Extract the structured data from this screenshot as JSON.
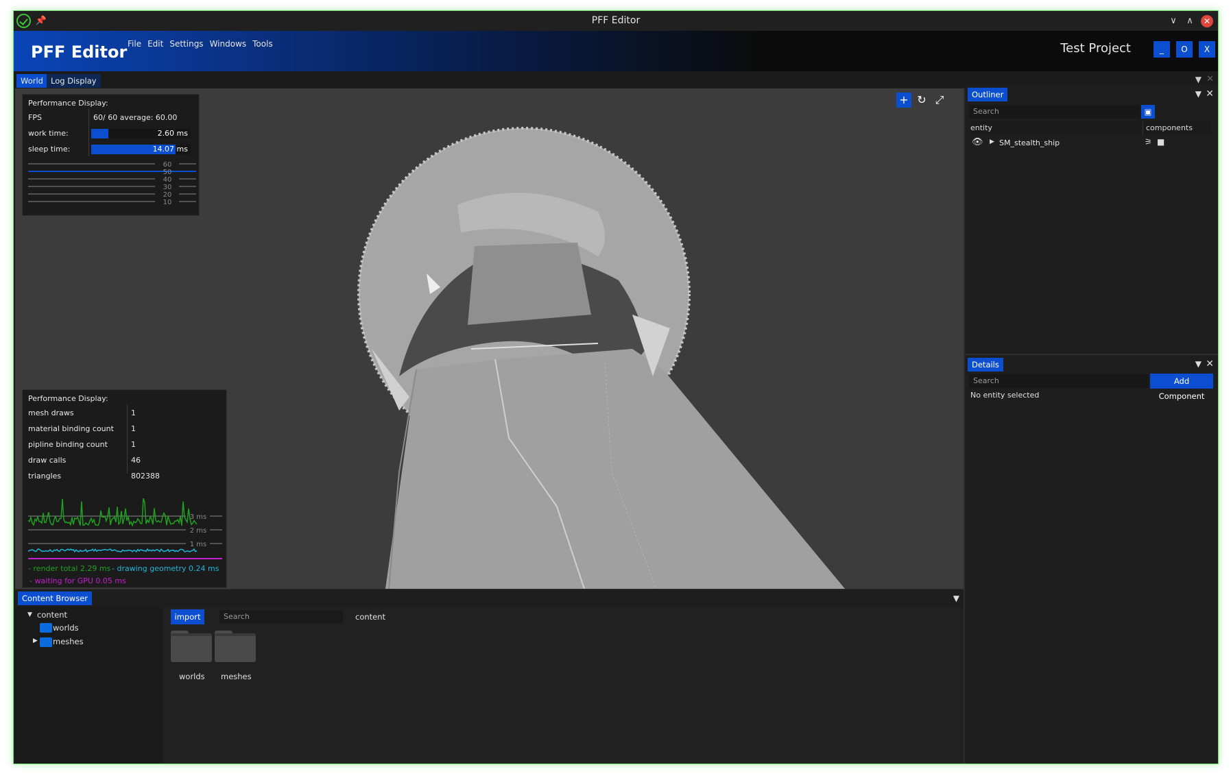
{
  "window": {
    "title": "PFF Editor"
  },
  "header": {
    "brand": "PFF Editor",
    "menu": [
      "File",
      "Edit",
      "Settings",
      "Windows",
      "Tools"
    ],
    "project": "Test Project",
    "buttons": [
      "_",
      "O",
      "X"
    ]
  },
  "tabs": [
    {
      "label": "World",
      "active": true
    },
    {
      "label": "Log Display",
      "active": false
    }
  ],
  "perf_top": {
    "title": "Performance Display:",
    "fps_label": "FPS",
    "fps_value": "60/  60  average: 60.00",
    "work_label": "work time:",
    "work_value": "2.60 ms",
    "work_fraction": 0.17,
    "sleep_label": "sleep time:",
    "sleep_value": "14.07 ms",
    "sleep_fraction": 0.85,
    "graph_ticks": [
      "60",
      "50",
      "40",
      "30",
      "20",
      "10"
    ]
  },
  "perf_bottom": {
    "title": "Performance Display:",
    "rows": [
      {
        "label": "mesh draws",
        "value": "1"
      },
      {
        "label": "material binding count",
        "value": "1"
      },
      {
        "label": "pipline binding count",
        "value": "1"
      },
      {
        "label": "draw calls",
        "value": "46"
      },
      {
        "label": "triangles",
        "value": "802388"
      }
    ],
    "graph_ticks": [
      "3 ms",
      "2 ms",
      "1 ms"
    ],
    "legend_render": "- render total  2.29 ms",
    "legend_geometry": "- drawing geometry  0.24 ms",
    "legend_gpu": "- waiting for GPU  0.05 ms",
    "colors": {
      "render": "#1fa11f",
      "geometry": "#1fb7d8",
      "gpu": "#c81fd0"
    }
  },
  "outliner": {
    "tab": "Outliner",
    "search_placeholder": "Search",
    "col_entity": "entity",
    "col_components": "components",
    "rows": [
      {
        "name": "SM_stealth_ship"
      }
    ]
  },
  "details": {
    "tab": "Details",
    "search_placeholder": "Search",
    "add_component": "Add Component",
    "empty": "No entity selected"
  },
  "content_browser": {
    "tab": "Content Browser",
    "tree_root": "content",
    "tree_items": [
      "worlds",
      "meshes"
    ],
    "import_label": "import",
    "search_placeholder": "Search",
    "path": "content",
    "folders": [
      "worlds",
      "meshes"
    ]
  },
  "colors": {
    "accent": "#0b4fd0",
    "viewport_bg": "#3c3c3c",
    "model": "#a6a6a6"
  }
}
